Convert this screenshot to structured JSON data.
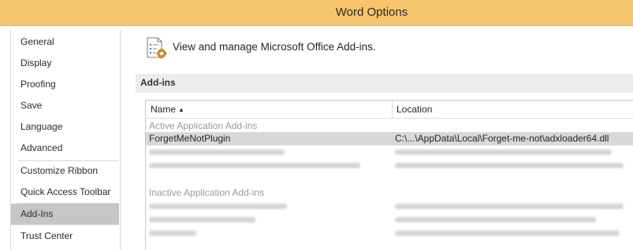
{
  "window": {
    "title": "Word Options"
  },
  "nav": {
    "items": [
      {
        "label": "General"
      },
      {
        "label": "Display"
      },
      {
        "label": "Proofing"
      },
      {
        "label": "Save"
      },
      {
        "label": "Language"
      },
      {
        "label": "Advanced"
      },
      {
        "label": "Customize Ribbon"
      },
      {
        "label": "Quick Access Toolbar"
      },
      {
        "label": "Add-Ins",
        "active": true
      },
      {
        "label": "Trust Center"
      }
    ]
  },
  "header": {
    "icon": "addins-gear-icon",
    "text": "View and manage Microsoft Office Add-ins."
  },
  "section": {
    "title": "Add-ins"
  },
  "table": {
    "columns": {
      "name": "Name",
      "location": "Location"
    },
    "sort_indicator": "▲",
    "groups": {
      "active": "Active Application Add-ins",
      "inactive": "Inactive Application Add-ins"
    },
    "selected_row": {
      "name": "ForgetMeNotPlugin",
      "location": "C:\\...\\AppData\\Local\\Forget-me-not\\adxloader64.dll"
    }
  },
  "colors": {
    "titlebar": "#f5c56b",
    "nav_active": "#c6c6c6",
    "section_bar": "#ececec",
    "selected_row": "#d8d8d8"
  }
}
